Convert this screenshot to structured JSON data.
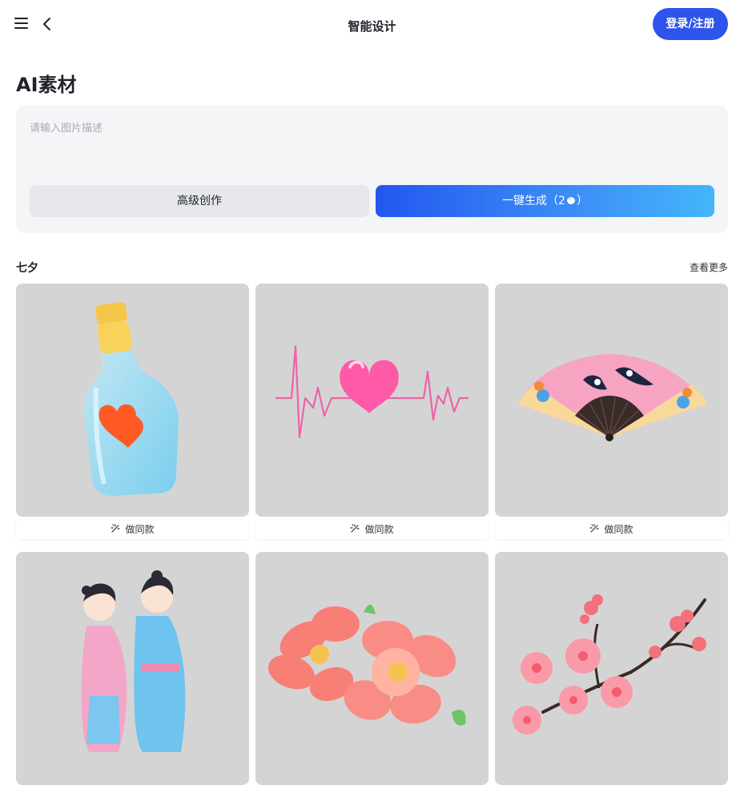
{
  "header": {
    "title": "智能设计",
    "login_label": "登录/注册"
  },
  "main": {
    "heading": "AI素材",
    "prompt_placeholder": "请输入图片描述",
    "advanced_label": "高级创作",
    "generate_label_prefix": "一键生成（2",
    "generate_label_suffix": "）"
  },
  "category": {
    "title": "七夕",
    "more_label": "查看更多",
    "make_same_label": "做同款",
    "items": [
      {
        "subject": "perfume-bottle-heart"
      },
      {
        "subject": "heartbeat-line-heart"
      },
      {
        "subject": "magpie-folding-fan"
      },
      {
        "subject": "hanfu-couple"
      },
      {
        "subject": "peach-blossoms"
      },
      {
        "subject": "plum-blossom-branch"
      }
    ]
  },
  "colors": {
    "accent": "#2f54eb",
    "gradient_start": "#2357f0",
    "gradient_end": "#44b6fb",
    "card_bg": "#d4d4d5",
    "prompt_bg": "#f4f5f7"
  }
}
